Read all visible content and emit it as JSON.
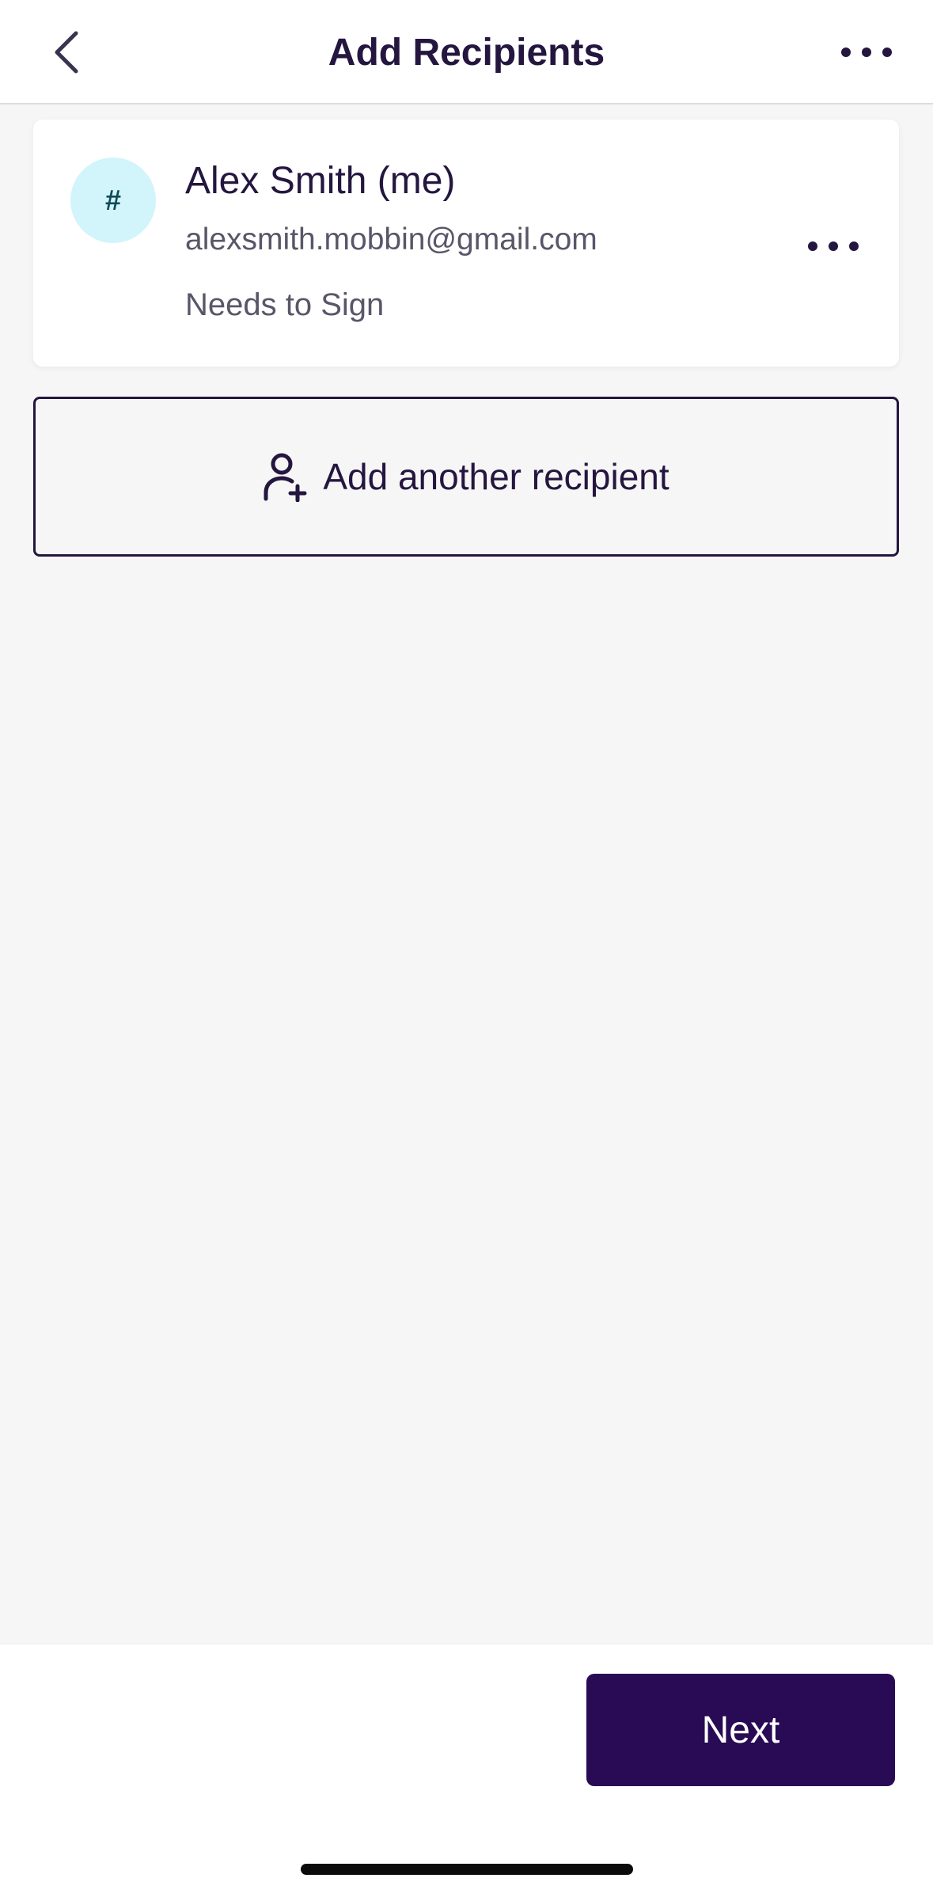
{
  "header": {
    "title": "Add Recipients",
    "back_icon": "chevron-left-icon",
    "more_icon": "more-horizontal-icon"
  },
  "recipients": [
    {
      "avatar_text": "#",
      "name": "Alex Smith (me)",
      "email": "alexsmith.mobbin@gmail.com",
      "role": "Needs to Sign",
      "more_icon": "more-horizontal-icon"
    }
  ],
  "add_recipient": {
    "label": "Add another recipient",
    "icon": "add-person-icon"
  },
  "footer": {
    "next_label": "Next"
  },
  "colors": {
    "brand_dark": "#280a55",
    "text_primary": "#24163f",
    "text_secondary": "#5a5568",
    "avatar_bg": "#d2f4fb",
    "background": "#f6f6f6"
  }
}
